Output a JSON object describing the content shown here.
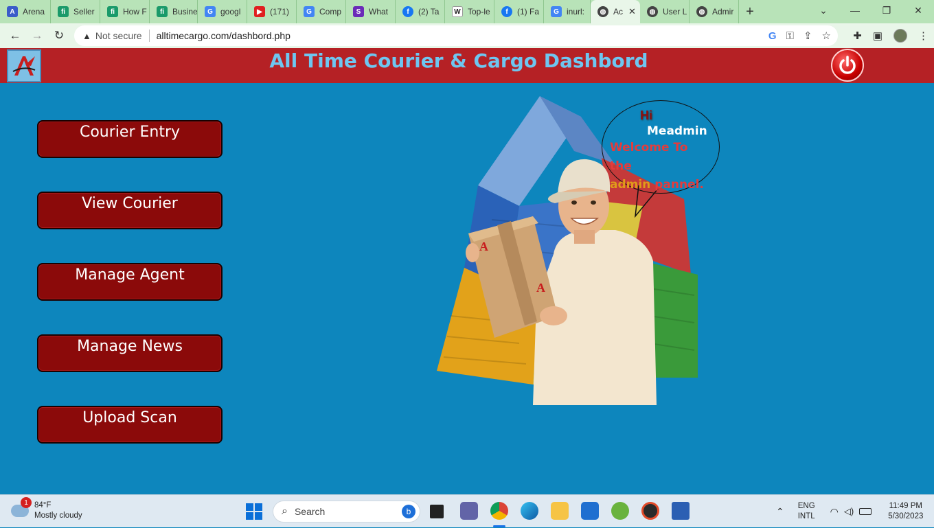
{
  "browser": {
    "tabs": [
      {
        "label": "Arena",
        "color": "#3b5cc9",
        "glyph": "A"
      },
      {
        "label": "Seller",
        "color": "#1a9a6a",
        "glyph": "fi"
      },
      {
        "label": "How F",
        "color": "#1a9a6a",
        "glyph": "fi"
      },
      {
        "label": "Busine",
        "color": "#1a9a6a",
        "glyph": "fi"
      },
      {
        "label": "googl",
        "color": "#4285f4",
        "glyph": "G"
      },
      {
        "label": "(171)",
        "color": "#e02020",
        "glyph": "▶"
      },
      {
        "label": "Comp",
        "color": "#4285f4",
        "glyph": "G"
      },
      {
        "label": "What",
        "color": "#6b2bb8",
        "glyph": "S"
      },
      {
        "label": "(2) Ta",
        "color": "#1877f2",
        "glyph": "f"
      },
      {
        "label": "Top-le",
        "color": "#222222",
        "glyph": "W"
      },
      {
        "label": "(1) Fa",
        "color": "#1877f2",
        "glyph": "f"
      },
      {
        "label": "inurl:",
        "color": "#4285f4",
        "glyph": "G"
      },
      {
        "label": "Ac",
        "color": "#444444",
        "glyph": "◍",
        "active": true
      },
      {
        "label": "User L",
        "color": "#444444",
        "glyph": "◍"
      },
      {
        "label": "Admir",
        "color": "#444444",
        "glyph": "◍"
      }
    ],
    "security_label": "Not secure",
    "url": "alltimecargo.com/dashbord.php"
  },
  "page": {
    "title": "All Time Courier & Cargo Dashbord",
    "menu": [
      {
        "label": "Courier Entry"
      },
      {
        "label": "View Courier"
      },
      {
        "label": "Manage Agent"
      },
      {
        "label": "Manage News"
      },
      {
        "label": "Upload Scan"
      }
    ],
    "greeting": {
      "hi": "Hi",
      "name": "Meadmin",
      "welcome_part1": "Welcome To the",
      "welcome_highlight": "admin",
      "welcome_part2": "pannel."
    }
  },
  "taskbar": {
    "weather_temp": "84°F",
    "weather_desc": "Mostly cloudy",
    "weather_badge": "1",
    "search_placeholder": "Search",
    "lang_line1": "ENG",
    "lang_line2": "INTL",
    "time": "11:49 PM",
    "date": "5/30/2023"
  },
  "colors": {
    "header_red": "#b52125",
    "page_blue": "#0d86bd",
    "button_red": "#8b0a0a",
    "title_blue": "#6ec6f0"
  }
}
